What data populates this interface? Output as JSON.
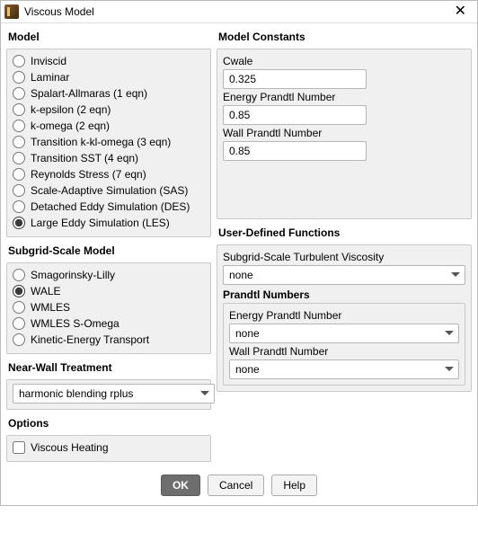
{
  "window": {
    "title": "Viscous Model"
  },
  "model": {
    "title": "Model",
    "selected": "Large Eddy Simulation (LES)",
    "options": [
      "Inviscid",
      "Laminar",
      "Spalart-Allmaras (1 eqn)",
      "k-epsilon (2 eqn)",
      "k-omega (2 eqn)",
      "Transition k-kl-omega (3 eqn)",
      "Transition SST (4 eqn)",
      "Reynolds Stress (7 eqn)",
      "Scale-Adaptive Simulation (SAS)",
      "Detached Eddy Simulation (DES)",
      "Large Eddy Simulation (LES)"
    ]
  },
  "sgs": {
    "title": "Subgrid-Scale Model",
    "selected": "WALE",
    "options": [
      "Smagorinsky-Lilly",
      "WALE",
      "WMLES",
      "WMLES S-Omega",
      "Kinetic-Energy Transport"
    ]
  },
  "nearwall": {
    "title": "Near-Wall Treatment",
    "value": "harmonic blending rplus"
  },
  "options": {
    "title": "Options",
    "viscous_heating": {
      "label": "Viscous Heating",
      "checked": false
    }
  },
  "constants": {
    "title": "Model Constants",
    "cwale": {
      "label": "Cwale",
      "value": "0.325"
    },
    "energy_prandtl": {
      "label": "Energy Prandtl Number",
      "value": "0.85"
    },
    "wall_prandtl": {
      "label": "Wall Prandtl Number",
      "value": "0.85"
    }
  },
  "udf": {
    "title": "User-Defined Functions",
    "sgs_visc": {
      "label": "Subgrid-Scale Turbulent Viscosity",
      "value": "none"
    },
    "prandtl": {
      "title": "Prandtl Numbers",
      "energy": {
        "label": "Energy Prandtl Number",
        "value": "none"
      },
      "wall": {
        "label": "Wall Prandtl Number",
        "value": "none"
      }
    }
  },
  "buttons": {
    "ok": "OK",
    "cancel": "Cancel",
    "help": "Help"
  }
}
